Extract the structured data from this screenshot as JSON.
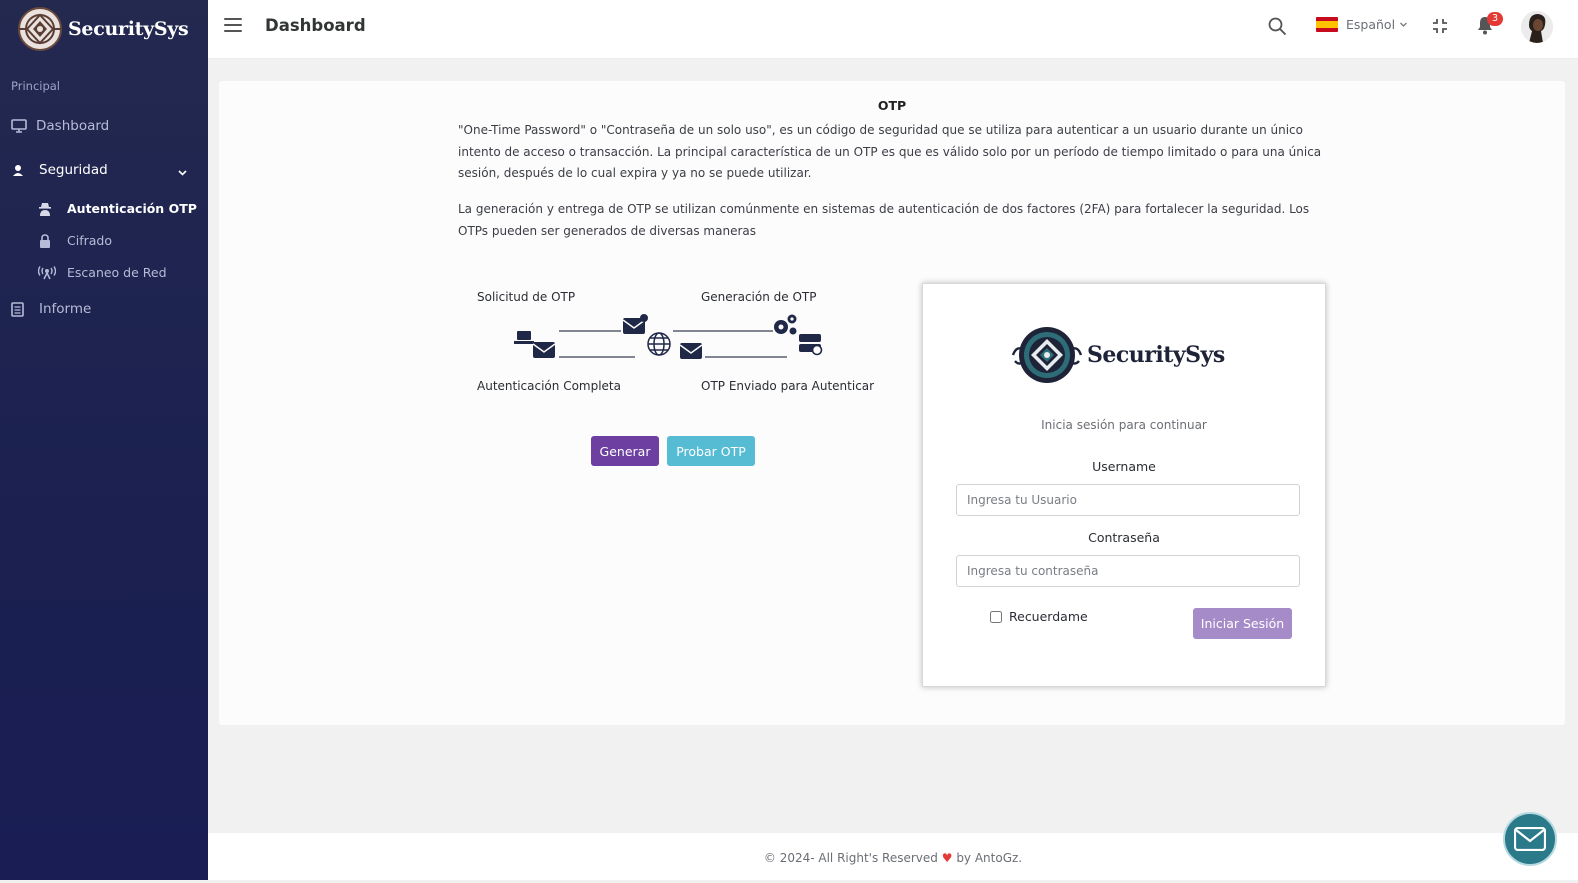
{
  "app": {
    "brand": "SecuritySys"
  },
  "sidebar": {
    "section": "Principal",
    "items": [
      {
        "label": "Dashboard",
        "icon": "monitor-icon"
      },
      {
        "label": "Seguridad",
        "icon": "shield-user-icon"
      },
      {
        "label": "Autenticación OTP",
        "icon": "user-secret-icon"
      },
      {
        "label": "Cifrado",
        "icon": "lock-icon"
      },
      {
        "label": "Escaneo de Red",
        "icon": "broadcast-icon"
      },
      {
        "label": "Informe",
        "icon": "document-icon"
      }
    ]
  },
  "header": {
    "title": "Dashboard",
    "language": "Español",
    "notifications": "3"
  },
  "main": {
    "title": "OTP",
    "paragraph1": "\"One-Time Password\" o \"Contraseña de un solo uso\", es un código de seguridad que se utiliza para autenticar a un usuario durante un único intento de acceso o transacción. La principal característica de un OTP es que es válido solo por un período de tiempo limitado o para una única sesión, después de lo cual expira y ya no se puede utilizar.",
    "paragraph2": "La generación y entrega de OTP se utilizan comúnmente en sistemas de autenticación de dos factores (2FA) para fortalecer la seguridad. Los OTPs pueden ser generados de diversas maneras",
    "diagram": {
      "label_request": "Solicitud de OTP",
      "label_generation": "Generación de OTP",
      "label_complete": "Autenticación Completa",
      "label_sent": "OTP Enviado para Autenticar"
    },
    "btn_generate": "Generar",
    "btn_test": "Probar OTP"
  },
  "login": {
    "brand": "SecuritySys",
    "subtitle": "Inicia sesión para continuar",
    "username_label": "Username",
    "username_placeholder": "Ingresa tu Usuario",
    "password_label": "Contraseña",
    "password_placeholder": "Ingresa tu contraseña",
    "remember": "Recuerdame",
    "submit": "Iniciar Sesión"
  },
  "footer": {
    "text_before": "© 2024- All Right's Reserved",
    "text_after": "by AntoGz."
  },
  "colors": {
    "sidebar_bg": "#1b2050",
    "primary_button": "#6c3fa0",
    "info_button": "#56bcd4",
    "login_button": "#a68bc9"
  }
}
